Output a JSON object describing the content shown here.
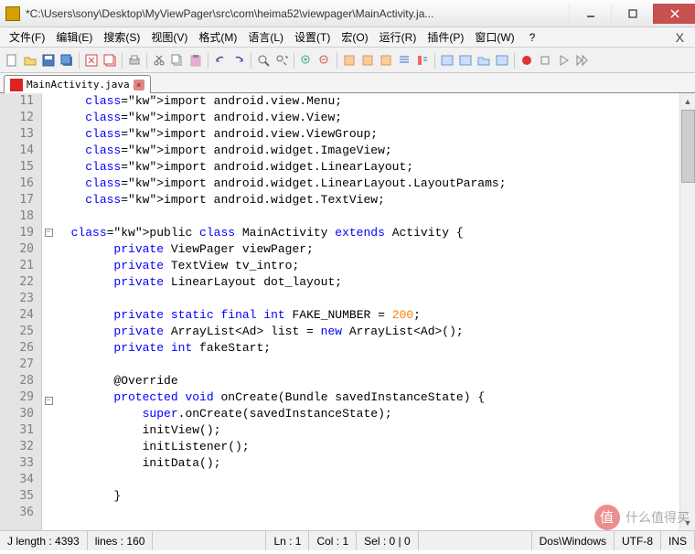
{
  "window": {
    "title": "*C:\\Users\\sony\\Desktop\\MyViewPager\\src\\com\\heima52\\viewpager\\MainActivity.ja..."
  },
  "menu": {
    "file": "文件(F)",
    "edit": "编辑(E)",
    "search": "搜索(S)",
    "view": "视图(V)",
    "format": "格式(M)",
    "lang": "语言(L)",
    "settings": "设置(T)",
    "macro": "宏(O)",
    "run": "运行(R)",
    "plugin": "插件(P)",
    "window": "窗口(W)",
    "help": "?"
  },
  "tab": {
    "label": "MainActivity.java"
  },
  "code": {
    "lines": [
      {
        "n": 11,
        "t": "    import android.view.Menu;"
      },
      {
        "n": 12,
        "t": "    import android.view.View;"
      },
      {
        "n": 13,
        "t": "    import android.view.ViewGroup;"
      },
      {
        "n": 14,
        "t": "    import android.widget.ImageView;"
      },
      {
        "n": 15,
        "t": "    import android.widget.LinearLayout;"
      },
      {
        "n": 16,
        "t": "    import android.widget.LinearLayout.LayoutParams;"
      },
      {
        "n": 17,
        "t": "    import android.widget.TextView;"
      },
      {
        "n": 18,
        "t": ""
      },
      {
        "n": 19,
        "t": "  public class MainActivity extends Activity {",
        "fold": "-"
      },
      {
        "n": 20,
        "t": "        private ViewPager viewPager;"
      },
      {
        "n": 21,
        "t": "        private TextView tv_intro;"
      },
      {
        "n": 22,
        "t": "        private LinearLayout dot_layout;"
      },
      {
        "n": 23,
        "t": ""
      },
      {
        "n": 24,
        "t": "        private static final int FAKE_NUMBER = 200;"
      },
      {
        "n": 25,
        "t": "        private ArrayList<Ad> list = new ArrayList<Ad>();"
      },
      {
        "n": 26,
        "t": "        private int fakeStart;"
      },
      {
        "n": 27,
        "t": ""
      },
      {
        "n": 28,
        "t": "        @Override"
      },
      {
        "n": 29,
        "t": "        protected void onCreate(Bundle savedInstanceState) {",
        "fold": "-"
      },
      {
        "n": 30,
        "t": "            super.onCreate(savedInstanceState);"
      },
      {
        "n": 31,
        "t": "            initView();"
      },
      {
        "n": 32,
        "t": "            initListener();"
      },
      {
        "n": 33,
        "t": "            initData();"
      },
      {
        "n": 34,
        "t": ""
      },
      {
        "n": 35,
        "t": "        }"
      },
      {
        "n": 36,
        "t": ""
      }
    ]
  },
  "status": {
    "length": "J length : 4393",
    "lines": "lines : 160",
    "ln": "Ln : 1",
    "col": "Col : 1",
    "sel": "Sel : 0 | 0",
    "eol": "Dos\\Windows",
    "enc": "UTF-8",
    "ins": "INS"
  },
  "watermark": "什么值得买"
}
